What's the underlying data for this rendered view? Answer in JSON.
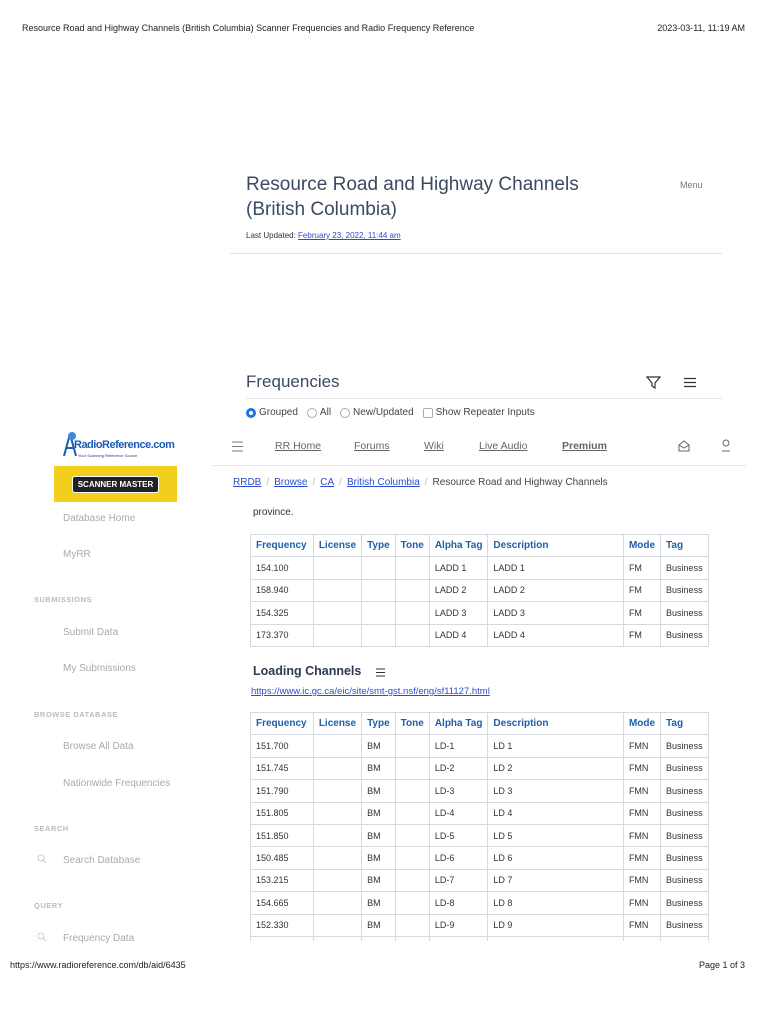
{
  "print_header": {
    "title": "Resource Road and Highway Channels (British Columbia) Scanner Frequencies and Radio Frequency Reference",
    "datetime": "2023-03-11, 11:19 AM"
  },
  "print_footer": {
    "url": "https://www.radioreference.com/db/aid/6435",
    "page": "Page 1 of 3"
  },
  "page": {
    "title_line1": "Resource Road and Highway Channels",
    "title_line2": "(British Columbia)",
    "menu": "Menu",
    "last_updated_label": "Last Updated:",
    "last_updated": "February 23, 2022, 11:44 am"
  },
  "frequencies": {
    "heading": "Frequencies",
    "options": [
      "Grouped",
      "All",
      "New/Updated"
    ],
    "checkbox": "Show Repeater Inputs"
  },
  "logo": {
    "text": "RadioReference.com",
    "tagline": "Your Scanning Reference Source",
    "ad": "SCANNER MASTER"
  },
  "nav": {
    "items": [
      "RR Home",
      "Forums",
      "Wiki",
      "Live Audio",
      "Premium"
    ]
  },
  "breadcrumb": {
    "items": [
      "RRDB",
      "Browse",
      "CA",
      "British Columbia"
    ],
    "current": "Resource Road and Highway Channels"
  },
  "sidebar": {
    "database_home": "Database Home",
    "myrr": "MyRR",
    "submissions": "SUBMISSIONS",
    "submit_data": "Submit Data",
    "my_submissions": "My Submissions",
    "browse_db": "BROWSE DATABASE",
    "browse_all": "Browse All Data",
    "nationwide": "Nationwide Frequencies",
    "search": "SEARCH",
    "search_db": "Search Database",
    "query": "QUERY",
    "freq_data": "Frequency Data"
  },
  "intro_tail": "province.",
  "columns": [
    "Frequency",
    "License",
    "Type",
    "Tone",
    "Alpha Tag",
    "Description",
    "Mode",
    "Tag"
  ],
  "table1": [
    [
      "154.100",
      "",
      "",
      "",
      "LADD 1",
      "LADD 1",
      "FM",
      "Business"
    ],
    [
      "158.940",
      "",
      "",
      "",
      "LADD 2",
      "LADD 2",
      "FM",
      "Business"
    ],
    [
      "154.325",
      "",
      "",
      "",
      "LADD 3",
      "LADD 3",
      "FM",
      "Business"
    ],
    [
      "173.370",
      "",
      "",
      "",
      "LADD 4",
      "LADD 4",
      "FM",
      "Business"
    ]
  ],
  "loading": {
    "heading": "Loading Channels",
    "link": "https://www.ic.gc.ca/eic/site/smt-gst.nsf/eng/sf11127.html"
  },
  "table2": [
    [
      "151.700",
      "",
      "BM",
      "",
      "LD-1",
      "LD 1",
      "FMN",
      "Business"
    ],
    [
      "151.745",
      "",
      "BM",
      "",
      "LD-2",
      "LD 2",
      "FMN",
      "Business"
    ],
    [
      "151.790",
      "",
      "BM",
      "",
      "LD-3",
      "LD 3",
      "FMN",
      "Business"
    ],
    [
      "151.805",
      "",
      "BM",
      "",
      "LD-4",
      "LD 4",
      "FMN",
      "Business"
    ],
    [
      "151.850",
      "",
      "BM",
      "",
      "LD-5",
      "LD 5",
      "FMN",
      "Business"
    ],
    [
      "150.485",
      "",
      "BM",
      "",
      "LD-6",
      "LD 6",
      "FMN",
      "Business"
    ],
    [
      "153.215",
      "",
      "BM",
      "",
      "LD-7",
      "LD 7",
      "FMN",
      "Business"
    ],
    [
      "154.665",
      "",
      "BM",
      "",
      "LD-8",
      "LD 8",
      "FMN",
      "Business"
    ],
    [
      "152.330",
      "",
      "BM",
      "",
      "LD-9",
      "LD 9",
      "FMN",
      "Business"
    ]
  ]
}
